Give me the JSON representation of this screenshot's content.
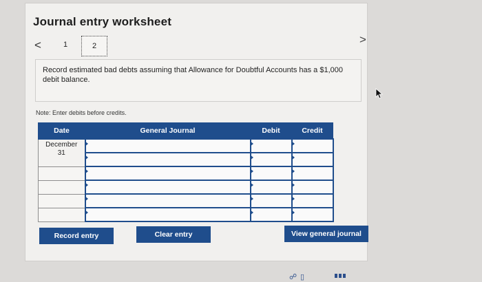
{
  "worksheet": {
    "title": "Journal entry worksheet",
    "pages": [
      "1",
      "2"
    ],
    "prev_glyph": "<",
    "next_glyph": ">"
  },
  "instruction": {
    "text": "Record estimated bad debts assuming that Allowance for Doubtful Accounts has a $1,000 debit balance."
  },
  "note": "Note: Enter debits before credits.",
  "table": {
    "headers": {
      "date": "Date",
      "general_journal": "General Journal",
      "debit": "Debit",
      "credit": "Credit"
    },
    "date_value": "December\n31"
  },
  "buttons": {
    "record": "Record entry",
    "clear": "Clear entry",
    "view": "View general journal"
  },
  "colors": {
    "accent": "#1f4d8c",
    "background": "#dcdad8",
    "panel": "#f1f0ee"
  },
  "icons": {
    "prev": "chevron-left-icon",
    "next": "chevron-right-icon",
    "cursor": "mouse-cursor-icon"
  }
}
